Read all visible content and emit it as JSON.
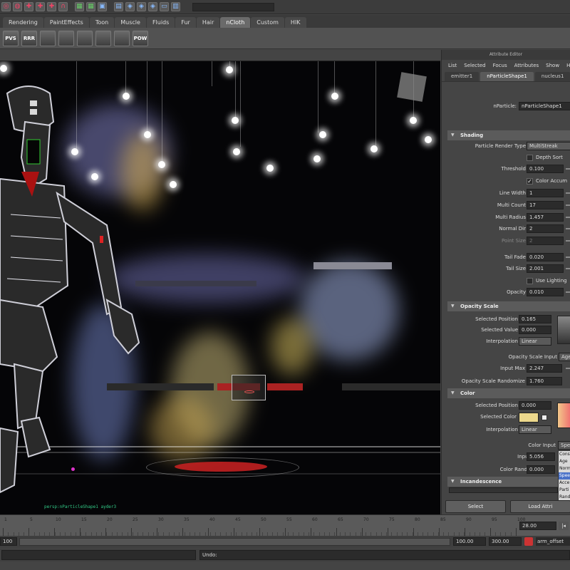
{
  "shelf_tabs": [
    "Rendering",
    "PaintEffects",
    "Toon",
    "Muscle",
    "Fluids",
    "Fur",
    "Hair",
    "nCloth",
    "Custom",
    "HIK"
  ],
  "shelf_tab_active": "nCloth",
  "shelf_icons": [
    "PVS",
    "RRR",
    "",
    "",
    "",
    "",
    "",
    "POW"
  ],
  "viewport": {
    "caption": "persp:nParticleShape1 ayder3"
  },
  "attribute_editor": {
    "title": "Attribute Editor",
    "menu": [
      "List",
      "Selected",
      "Focus",
      "Attributes",
      "Show",
      "H"
    ],
    "tabs": [
      "emitter1",
      "nParticleShape1",
      "nucleus1"
    ],
    "node_label": "nParticle:",
    "node_value": "nParticleShape1",
    "shading": {
      "header": "Shading",
      "particle_render_type_label": "Particle Render Type",
      "particle_render_type": "MultiStreak",
      "depth_sort_label": "Depth Sort",
      "threshold_label": "Threshold",
      "threshold": "0.100",
      "color_accum_label": "Color Accum",
      "line_width_label": "Line Width",
      "line_width": "1",
      "multi_count_label": "Multi Count",
      "multi_count": "17",
      "multi_radius_label": "Multi Radius",
      "multi_radius": "1.457",
      "normal_dir_label": "Normal Dir",
      "normal_dir": "2",
      "point_size_label": "Point Size",
      "point_size": "2",
      "tail_fade_label": "Tail Fade",
      "tail_fade": "0.020",
      "tail_size_label": "Tail Size",
      "tail_size": "2.001",
      "use_lighting_label": "Use Lighting",
      "opacity_label": "Opacity",
      "opacity": "0.010"
    },
    "opacity_scale": {
      "header": "Opacity Scale",
      "selected_position_label": "Selected Position",
      "selected_position": "0.165",
      "selected_value_label": "Selected Value",
      "selected_value": "0.000",
      "interpolation_label": "Interpolation",
      "interpolation": "Linear",
      "input_label": "Opacity Scale Input",
      "input": "Age",
      "input_max_label": "Input Max",
      "input_max": "2.247",
      "randomize_label": "Opacity Scale Randomize",
      "randomize": "1.760"
    },
    "color": {
      "header": "Color",
      "selected_position_label": "Selected Position",
      "selected_position": "0.000",
      "selected_color_label": "Selected Color",
      "selected_color_hex": "#ecd88c",
      "interpolation_label": "Interpolation",
      "interpolation": "Linear",
      "color_input_label": "Color Input",
      "color_input": "Spee",
      "input_max_label": "Input Max",
      "input_max": "5.056",
      "randomize_label": "Color Randomize",
      "randomize": "0.000",
      "dropdown_options": [
        "Cons",
        "Age",
        "Norm",
        "Spee",
        "Acce",
        "Parti",
        "Rand",
        "Radi"
      ],
      "dropdown_selected": "Spee"
    },
    "incandescence_header": "Incandescence",
    "buttons": {
      "select": "Select",
      "load": "Load Attri"
    }
  },
  "timeline": {
    "labels": [
      "1",
      "5",
      "10",
      "15",
      "20",
      "25",
      "30",
      "35",
      "40",
      "45",
      "50",
      "55",
      "60",
      "65",
      "70",
      "75",
      "80",
      "85",
      "90",
      "95",
      "100"
    ],
    "current_time": "28.00"
  },
  "range": {
    "start": "100",
    "end_a": "100.00",
    "end_b": "300.00",
    "char_set": "arm_offset"
  },
  "command_line": {
    "output_label": "Undo:"
  }
}
